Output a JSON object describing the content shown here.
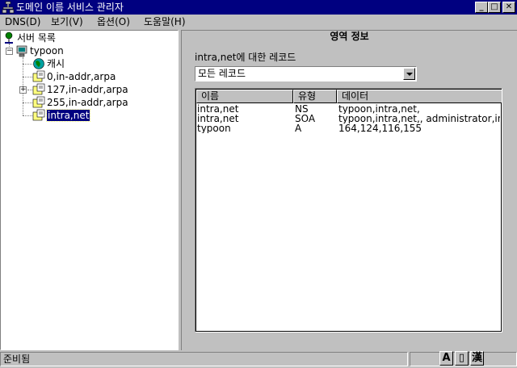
{
  "window": {
    "title": "도메인 이름 서비스 관리자",
    "minimize_glyph": "_",
    "maximize_glyph": "□",
    "close_glyph": "✕"
  },
  "menu": {
    "items": [
      "DNS(D)",
      "보기(V)",
      "옵션(O)",
      "도움말(H)"
    ]
  },
  "tree": {
    "root": {
      "label": "서버 목록",
      "icon": "server-list-icon"
    },
    "server": {
      "label": "typoon",
      "icon": "server-icon"
    },
    "children": [
      {
        "label": "캐시",
        "icon": "cache-globe-icon"
      },
      {
        "label": "0,in-addr,arpa",
        "icon": "zone-folder-icon"
      },
      {
        "label": "127,in-addr,arpa",
        "icon": "zone-folder-icon"
      },
      {
        "label": "255,in-addr,arpa",
        "icon": "zone-folder-icon"
      },
      {
        "label": "intra,net",
        "icon": "zone-folder-icon",
        "selected": true
      }
    ]
  },
  "zone_info": {
    "section_title": "영역 정보",
    "records_label": "intra,net에 대한 레코드",
    "filter_value": "모든 레코드",
    "columns": [
      "이름",
      "유형",
      "데이터"
    ],
    "rows": [
      {
        "name": "intra,net",
        "type": "NS",
        "data": "typoon,intra,net,"
      },
      {
        "name": "intra,net",
        "type": "SOA",
        "data": "typoon,intra,net,, administrator,intra"
      },
      {
        "name": "typoon",
        "type": "A",
        "data": "164,124,116,155"
      }
    ]
  },
  "status": {
    "text": "준비됨",
    "ime": [
      "A",
      "▯",
      "漢"
    ]
  },
  "colors": {
    "title_bar": "#000080",
    "face": "#c0c0c0",
    "selection": "#000080"
  }
}
